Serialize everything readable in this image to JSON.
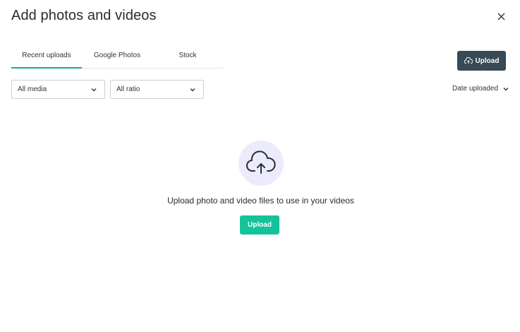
{
  "dialog": {
    "title": "Add photos and videos",
    "close_icon": "close-icon"
  },
  "tabs": [
    {
      "label": "Recent uploads",
      "active": true
    },
    {
      "label": "Google Photos",
      "active": false
    },
    {
      "label": "Stock",
      "active": false
    }
  ],
  "toolbar": {
    "upload_label": "Upload",
    "upload_icon": "cloud-upload-icon",
    "media_filter": {
      "selected": "All media"
    },
    "ratio_filter": {
      "selected": "All ratio"
    },
    "sort": {
      "label": "Date uploaded"
    }
  },
  "empty_state": {
    "icon": "cloud-upload-icon",
    "message": "Upload photo and video files to use in your videos",
    "button_label": "Upload"
  },
  "colors": {
    "accent": "#15c39a",
    "tab_underline": "#1aa99a",
    "upload_button": "#374a56",
    "icon_circle": "#ecebfb"
  }
}
